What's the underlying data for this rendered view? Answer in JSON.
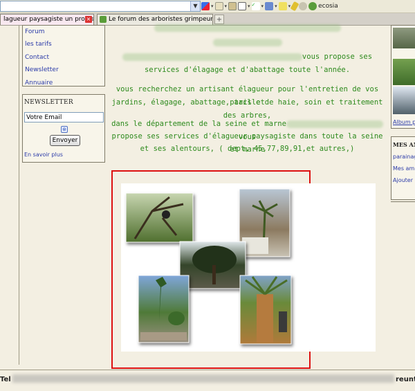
{
  "toolbar": {
    "url_value": "",
    "search_engine_label": "ecosia",
    "colors": {
      "accent": "#2d8a1d",
      "link": "#2a3aa8",
      "highlight": "#d11111"
    }
  },
  "tabs": [
    {
      "label": "lagueur paysagiste un professio..."
    },
    {
      "label": "Le forum des arboristes grimpeurs, des..."
    }
  ],
  "sidebar": {
    "menu_items": [
      "Forum",
      "les tarifs",
      "Contact",
      "Newsletter",
      "Annuaire"
    ],
    "newsletter": {
      "title": "NEWSLETTER",
      "email_placeholder": "Votre Email",
      "submit_label": "Envoyer",
      "more_link": "En savoir plus"
    }
  },
  "main": {
    "p1_tail": "vous propose ses",
    "p1_line2": "services d'élagage et d'abattage toute l'année.",
    "p2_line1": "vous recherchez un artisant élagueur pour l'entretien de vos parcs et",
    "p2_line2": "jardins, élagage, abattage, taille de haie, soin et traitement des arbres,",
    "p3_head": "dans le département de la seine et marne",
    "p3_tail": "vous",
    "p3_line2": "propose ses services d'élagueur paysagiste dans toute la seine et marne",
    "p3_line3": "et ses alentours, ( dept, 45,77,89,91,et autres,)"
  },
  "rightbar": {
    "album_label": "Album p",
    "section_title": "MES AM",
    "links": [
      "parainag",
      "Mes ami",
      "Ajouter"
    ]
  },
  "footer": {
    "left_text": "Tel",
    "right_text": "reunt"
  }
}
